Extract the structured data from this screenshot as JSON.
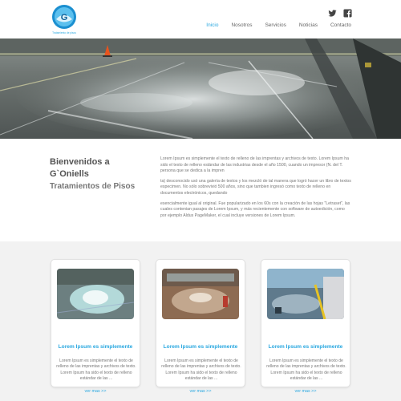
{
  "header": {
    "logo_caption": "Tratamiento de pisos",
    "social": [
      {
        "icon": "twitter-icon"
      },
      {
        "icon": "facebook-icon"
      }
    ],
    "nav": [
      {
        "label": "Inicio",
        "active": true
      },
      {
        "label": "Nosotros",
        "active": false
      },
      {
        "label": "Servicios",
        "active": false
      },
      {
        "label": "Noticias",
        "active": false
      },
      {
        "label": "Contacto",
        "active": false
      }
    ]
  },
  "welcome": {
    "title_line1": "Bienvenidos a",
    "title_line2": "G`Oniells",
    "title_line3": "Tratamientos de Pisos",
    "paragraphs": [
      "Lorem Ipsum es simplemente el texto de relleno de las imprentas y archivos de texto. Lorem Ipsum ha sido el texto de relleno estándar de las industrias desde el año 1500, cuando un impresor (N. del T. persona que se dedica a la impren",
      "ta) desconocido usó una galería de textos y los mezcló de tal manera que logró hacer un libro de textos especimen. No sólo sobrevivió 500 años, sino que tambien ingresó como texto de relleno en documentos electrónicos, quedando",
      "esencialmente igual al original. Fue popularizado en los 60s con la creación de las hojas \"Letraset\", las cuales contenian pasajes de Lorem Ipsum, y más recientemente con software de autoedición, como por ejemplo Aldus PageMaker, el cual incluye versiones de Lorem Ipsum."
    ]
  },
  "cards": [
    {
      "title": "Lorem Ipsum es simplemente",
      "text": "Lorem Ipsum es simplemente el texto de relleno de las imprentas y archivos de texto. Lorem Ipsum ha sido el texto de relleno estándar de las ...",
      "more": "ver mas >>"
    },
    {
      "title": "Lorem Ipsum es simplemente",
      "text": "Lorem Ipsum es simplemente el texto de relleno de las imprentas y archivos de texto. Lorem Ipsum ha sido el texto de relleno estándar de las ...",
      "more": "ver mas >>"
    },
    {
      "title": "Lorem Ipsum es simplemente",
      "text": "Lorem Ipsum es simplemente el texto de relleno de las imprentas y archivos de texto. Lorem Ipsum ha sido el texto de relleno estándar de las ...",
      "more": "ver mas >>"
    }
  ],
  "colors": {
    "accent": "#2aa8e0",
    "section_bg": "#f2f2f2"
  }
}
